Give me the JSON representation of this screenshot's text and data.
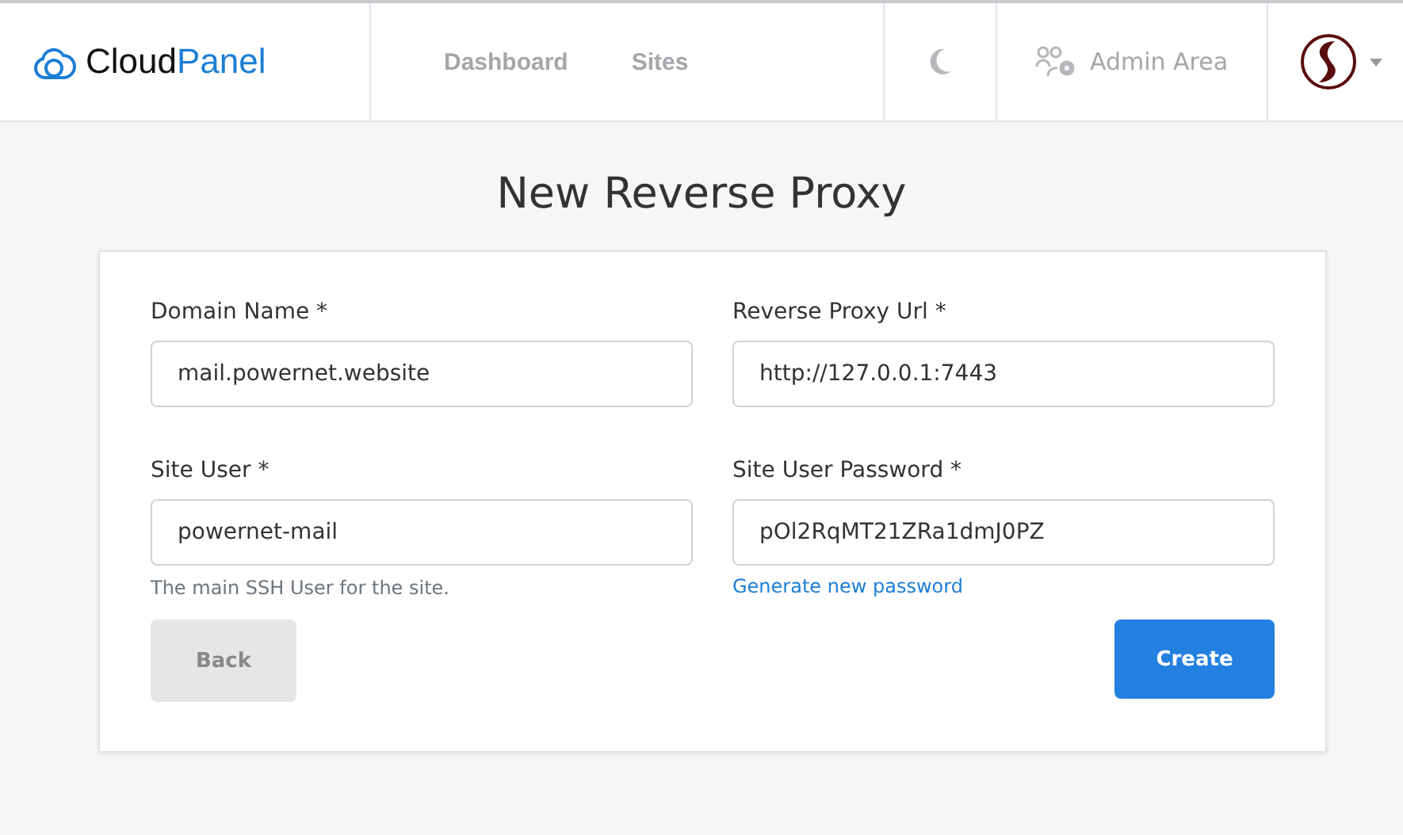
{
  "header": {
    "logo": {
      "dark_part": "Cloud",
      "blue_part": "Panel"
    },
    "nav": [
      {
        "label": "Dashboard"
      },
      {
        "label": "Sites"
      }
    ],
    "admin_area": "Admin Area"
  },
  "page_title": "New Reverse Proxy",
  "form": {
    "fields": [
      {
        "label": "Domain Name *",
        "value": "mail.powernet.website"
      },
      {
        "label": "Reverse Proxy Url *",
        "value": "http://127.0.0.1:7443"
      },
      {
        "label": "Site User *",
        "value": "powernet-mail",
        "help": "The main SSH User for the site."
      },
      {
        "label": "Site User Password *",
        "value": "pOl2RqMT21ZRa1dmJ0PZ",
        "link": "Generate new password"
      }
    ],
    "back_button": "Back",
    "create_button": "Create"
  }
}
